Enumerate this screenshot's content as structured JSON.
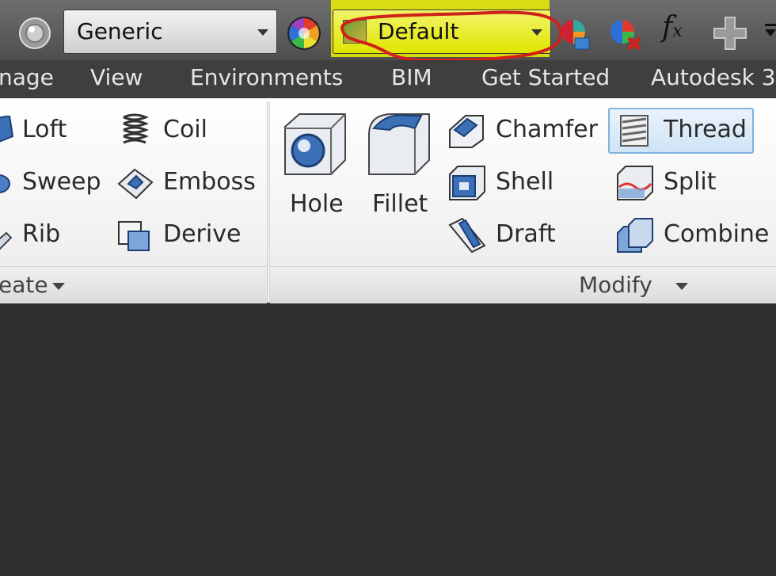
{
  "toolbar": {
    "material_dropdown": {
      "value": "Generic"
    },
    "appearance_dropdown": {
      "value": "Default"
    },
    "icons": [
      "material-sphere-icon",
      "color-wheel-icon",
      "appearance-browser-icon",
      "clear-appearance-icon",
      "fx-parameters-icon",
      "add-icon",
      "customize-dropdown-icon"
    ],
    "fx_label": "f",
    "fx_sub": "x"
  },
  "tabs": [
    "nage",
    "View",
    "Environments",
    "BIM",
    "Get Started",
    "Autodesk 3"
  ],
  "ribbon": {
    "create": {
      "label": "eate",
      "col1": [
        "Loft",
        "Sweep",
        "Rib"
      ],
      "col2": [
        "Coil",
        "Emboss",
        "Derive"
      ]
    },
    "modify": {
      "label": "Modify",
      "large": [
        "Hole",
        "Fillet"
      ],
      "col1": [
        "Chamfer",
        "Shell",
        "Draft"
      ],
      "col2": [
        "Thread",
        "Split",
        "Combine"
      ]
    }
  },
  "colors": {
    "highlight_yellow": "#ecf000",
    "annotation_red": "#d0201a",
    "accent_blue": "#3b6fb6",
    "selected_border": "#7fb2dc"
  }
}
